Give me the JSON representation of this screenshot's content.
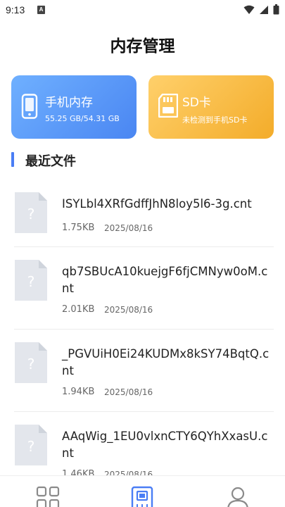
{
  "status_bar": {
    "time": "9:13",
    "notification_badge": "A"
  },
  "page": {
    "title": "内存管理"
  },
  "cards": {
    "phone": {
      "title": "手机内存",
      "subtitle": "55.25 GB/54.31 GB",
      "icon": "phone-icon"
    },
    "sd": {
      "title": "SD卡",
      "subtitle": "未检测到手机SD卡",
      "icon": "sd-card-icon"
    }
  },
  "recent": {
    "title": "最近文件",
    "files": [
      {
        "name": "ISYLbl4XRfGdffJhN8loy5l6-3g.cnt",
        "size": "1.75KB",
        "date": "2025/08/16"
      },
      {
        "name": "qb7SBUcA10kuejgF6fjCMNyw0oM.cnt",
        "size": "2.01KB",
        "date": "2025/08/16"
      },
      {
        "name": "_PGVUiH0Ei24KUDMx8kSY74BqtQ.cnt",
        "size": "1.94KB",
        "date": "2025/08/16"
      },
      {
        "name": "AAqWig_1EU0vlxnCTY6QYhXxasU.cnt",
        "size": "1.46KB",
        "date": "2025/08/16"
      }
    ]
  },
  "colors": {
    "accent": "#4a7ef5",
    "phone_card": "#5b97f6",
    "sd_card": "#f6b73c"
  },
  "bottom_nav": {
    "items": [
      {
        "icon": "grid-icon",
        "active": false
      },
      {
        "icon": "storage-icon",
        "active": true
      },
      {
        "icon": "user-icon",
        "active": false
      }
    ]
  }
}
